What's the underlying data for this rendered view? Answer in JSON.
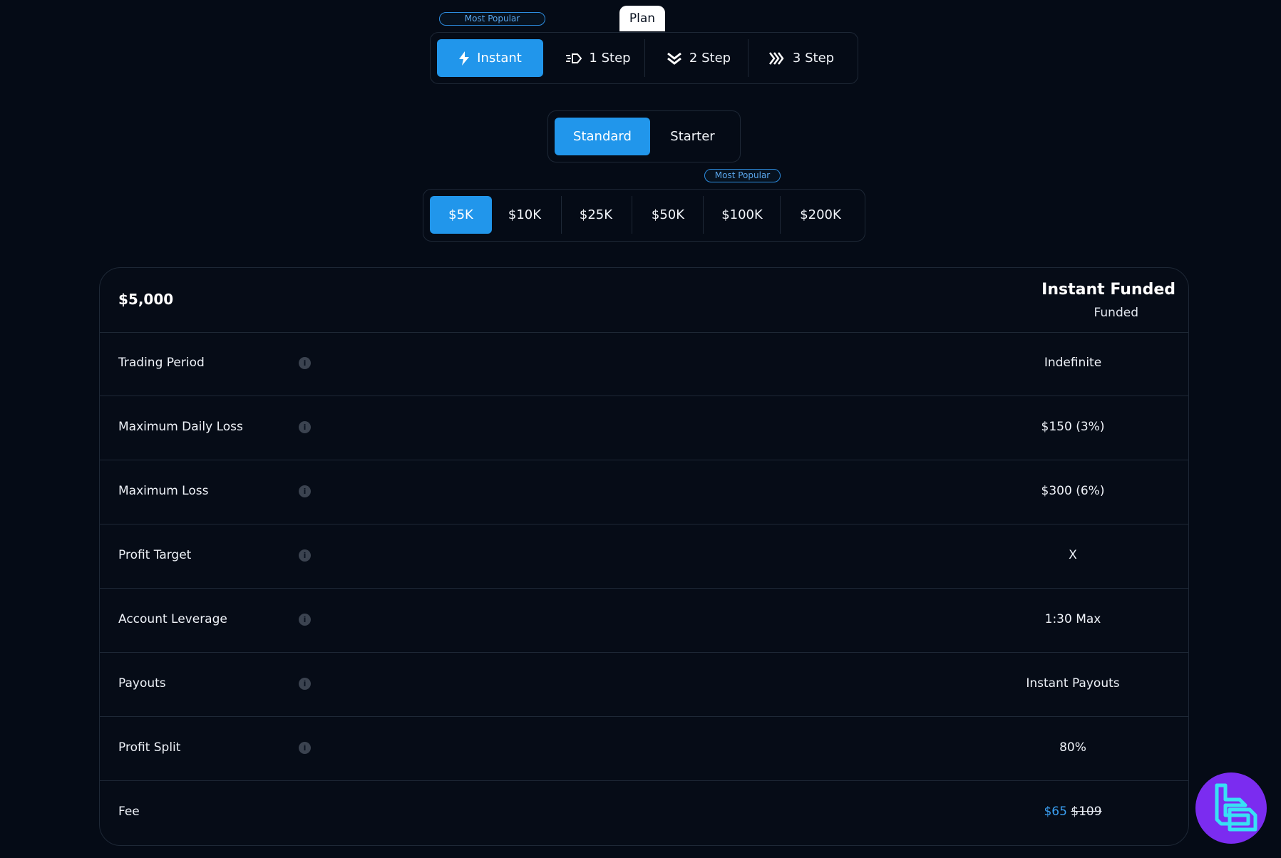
{
  "plan_tabs": {
    "badge": "Most Popular",
    "header_label": "Plan",
    "items": [
      {
        "label": "Instant",
        "icon": "lightning-icon",
        "active": true
      },
      {
        "label": "1 Step",
        "icon": "fast-forward-dash-icon",
        "active": false
      },
      {
        "label": "2 Step",
        "icon": "double-chevron-down-icon",
        "active": false
      },
      {
        "label": "3 Step",
        "icon": "triple-chevron-right-icon",
        "active": false
      }
    ]
  },
  "type_tabs": {
    "items": [
      {
        "label": "Standard",
        "active": true
      },
      {
        "label": "Starter",
        "active": false
      }
    ]
  },
  "size_tabs": {
    "badge": "Most Popular",
    "items": [
      {
        "label": "$5K",
        "active": true
      },
      {
        "label": "$10K",
        "active": false
      },
      {
        "label": "$25K",
        "active": false
      },
      {
        "label": "$50K",
        "active": false
      },
      {
        "label": "$100K",
        "active": false
      },
      {
        "label": "$200K",
        "active": false
      }
    ]
  },
  "card": {
    "amount": "$5,000",
    "plan_title": "Instant Funded",
    "plan_subtitle": "Funded",
    "rows": [
      {
        "label": "Trading Period",
        "value": "Indefinite"
      },
      {
        "label": "Maximum Daily Loss",
        "value": "$150 (3%)"
      },
      {
        "label": "Maximum Loss",
        "value": "$300 (6%)"
      },
      {
        "label": "Profit Target",
        "value": "X"
      },
      {
        "label": "Account Leverage",
        "value": "1:30 Max"
      },
      {
        "label": "Payouts",
        "value": "Instant Payouts"
      },
      {
        "label": "Profit Split",
        "value": "80%"
      }
    ],
    "fee": {
      "label": "Fee",
      "price": "$65",
      "original_price": "$109"
    }
  },
  "colors": {
    "accent": "#2196eb",
    "background": "#050b16",
    "logo": "#7b2cf0"
  }
}
